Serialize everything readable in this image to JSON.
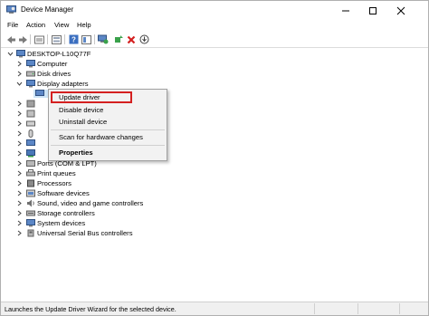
{
  "window": {
    "title": "Device Manager"
  },
  "menubar": {
    "items": [
      "File",
      "Action",
      "View",
      "Help"
    ]
  },
  "toolbar": {
    "buttons": [
      "back-arrow-icon",
      "forward-arrow-icon",
      "properties-icon",
      "list-view-icon",
      "help-icon",
      "show-icon",
      "scan-hardware-icon",
      "add-driver-icon",
      "uninstall-x-icon",
      "download-icon"
    ]
  },
  "tree": {
    "root": "DESKTOP-L10Q77F",
    "items": [
      {
        "label": "Computer"
      },
      {
        "label": "Disk drives"
      },
      {
        "label": "Display adapters"
      },
      {
        "label": "Ports (COM & LPT)"
      },
      {
        "label": "Print queues"
      },
      {
        "label": "Processors"
      },
      {
        "label": "Software devices"
      },
      {
        "label": "Sound, video and game controllers"
      },
      {
        "label": "Storage controllers"
      },
      {
        "label": "System devices"
      },
      {
        "label": "Universal Serial Bus controllers"
      }
    ]
  },
  "context_menu": {
    "items": [
      "Update driver",
      "Disable device",
      "Uninstall device",
      "Scan for hardware changes",
      "Properties"
    ]
  },
  "status": {
    "text": "Launches the Update Driver Wizard for the selected device."
  },
  "colors": {
    "accent": "#1f5fb8",
    "highlight_box": "#d42020"
  }
}
